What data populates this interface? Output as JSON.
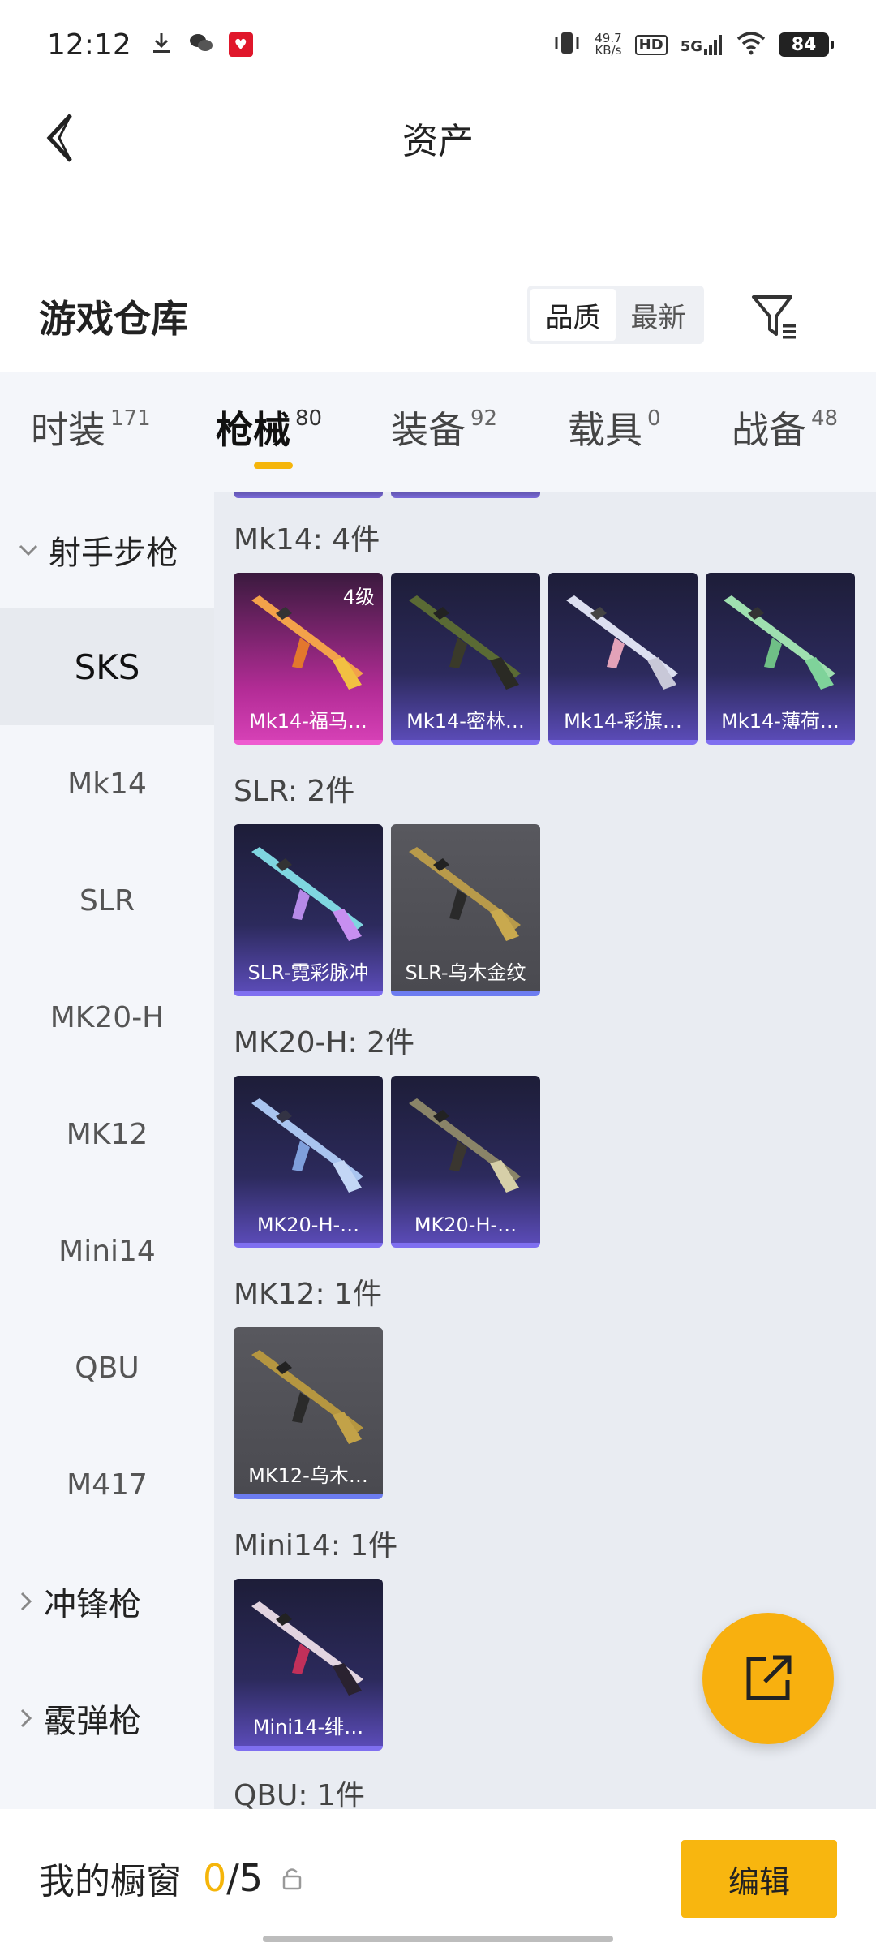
{
  "status_bar": {
    "time": "12:12",
    "net_speed_value": "49.7",
    "net_speed_unit": "KB/s",
    "hd_label": "HD",
    "signal_label": "5G",
    "battery": "84"
  },
  "header": {
    "title": "资产"
  },
  "storage": {
    "title": "游戏仓库",
    "sort_options": [
      "品质",
      "最新"
    ],
    "sort_active": "品质"
  },
  "tabs": [
    {
      "label": "时装",
      "count": "171"
    },
    {
      "label": "枪械",
      "count": "80"
    },
    {
      "label": "装备",
      "count": "92"
    },
    {
      "label": "载具",
      "count": "0"
    },
    {
      "label": "战备",
      "count": "48"
    }
  ],
  "sidebar": {
    "groups": [
      {
        "label": "射手步枪",
        "expanded": true
      },
      {
        "label": "冲锋枪",
        "expanded": false
      },
      {
        "label": "霰弹枪",
        "expanded": false
      }
    ],
    "items": [
      "SKS",
      "Mk14",
      "SLR",
      "MK20-H",
      "MK12",
      "Mini14",
      "QBU",
      "M417"
    ],
    "active_item": "SKS"
  },
  "sections": [
    {
      "label": "Mk14: 4件",
      "cards": [
        {
          "name": "Mk14-福马…",
          "level": "4级",
          "style": "pink"
        },
        {
          "name": "Mk14-密林…",
          "style": "purple"
        },
        {
          "name": "Mk14-彩旗…",
          "style": "purple"
        },
        {
          "name": "Mk14-薄荷…",
          "style": "purple"
        }
      ]
    },
    {
      "label": "SLR: 2件",
      "cards": [
        {
          "name": "SLR-霓彩脉冲",
          "style": "purple"
        },
        {
          "name": "SLR-乌木金纹",
          "style": "gray"
        }
      ]
    },
    {
      "label": "MK20-H: 2件",
      "cards": [
        {
          "name": "MK20-H-…",
          "style": "purple"
        },
        {
          "name": "MK20-H-…",
          "style": "purple"
        }
      ]
    },
    {
      "label": "MK12: 1件",
      "cards": [
        {
          "name": "MK12-乌木…",
          "style": "gray"
        }
      ]
    },
    {
      "label": "Mini14: 1件",
      "cards": [
        {
          "name": "Mini14-绯…",
          "style": "purple"
        }
      ]
    },
    {
      "label": "QBU: 1件",
      "cards": []
    }
  ],
  "bottom_bar": {
    "title": "我的橱窗",
    "count_current": "0",
    "count_total": "/5",
    "edit_label": "编辑"
  },
  "colors": {
    "accent": "#f8b60f",
    "card_purple": "#2c2a5c",
    "card_pink": "#b32c96",
    "card_gray": "#4a4a50"
  }
}
